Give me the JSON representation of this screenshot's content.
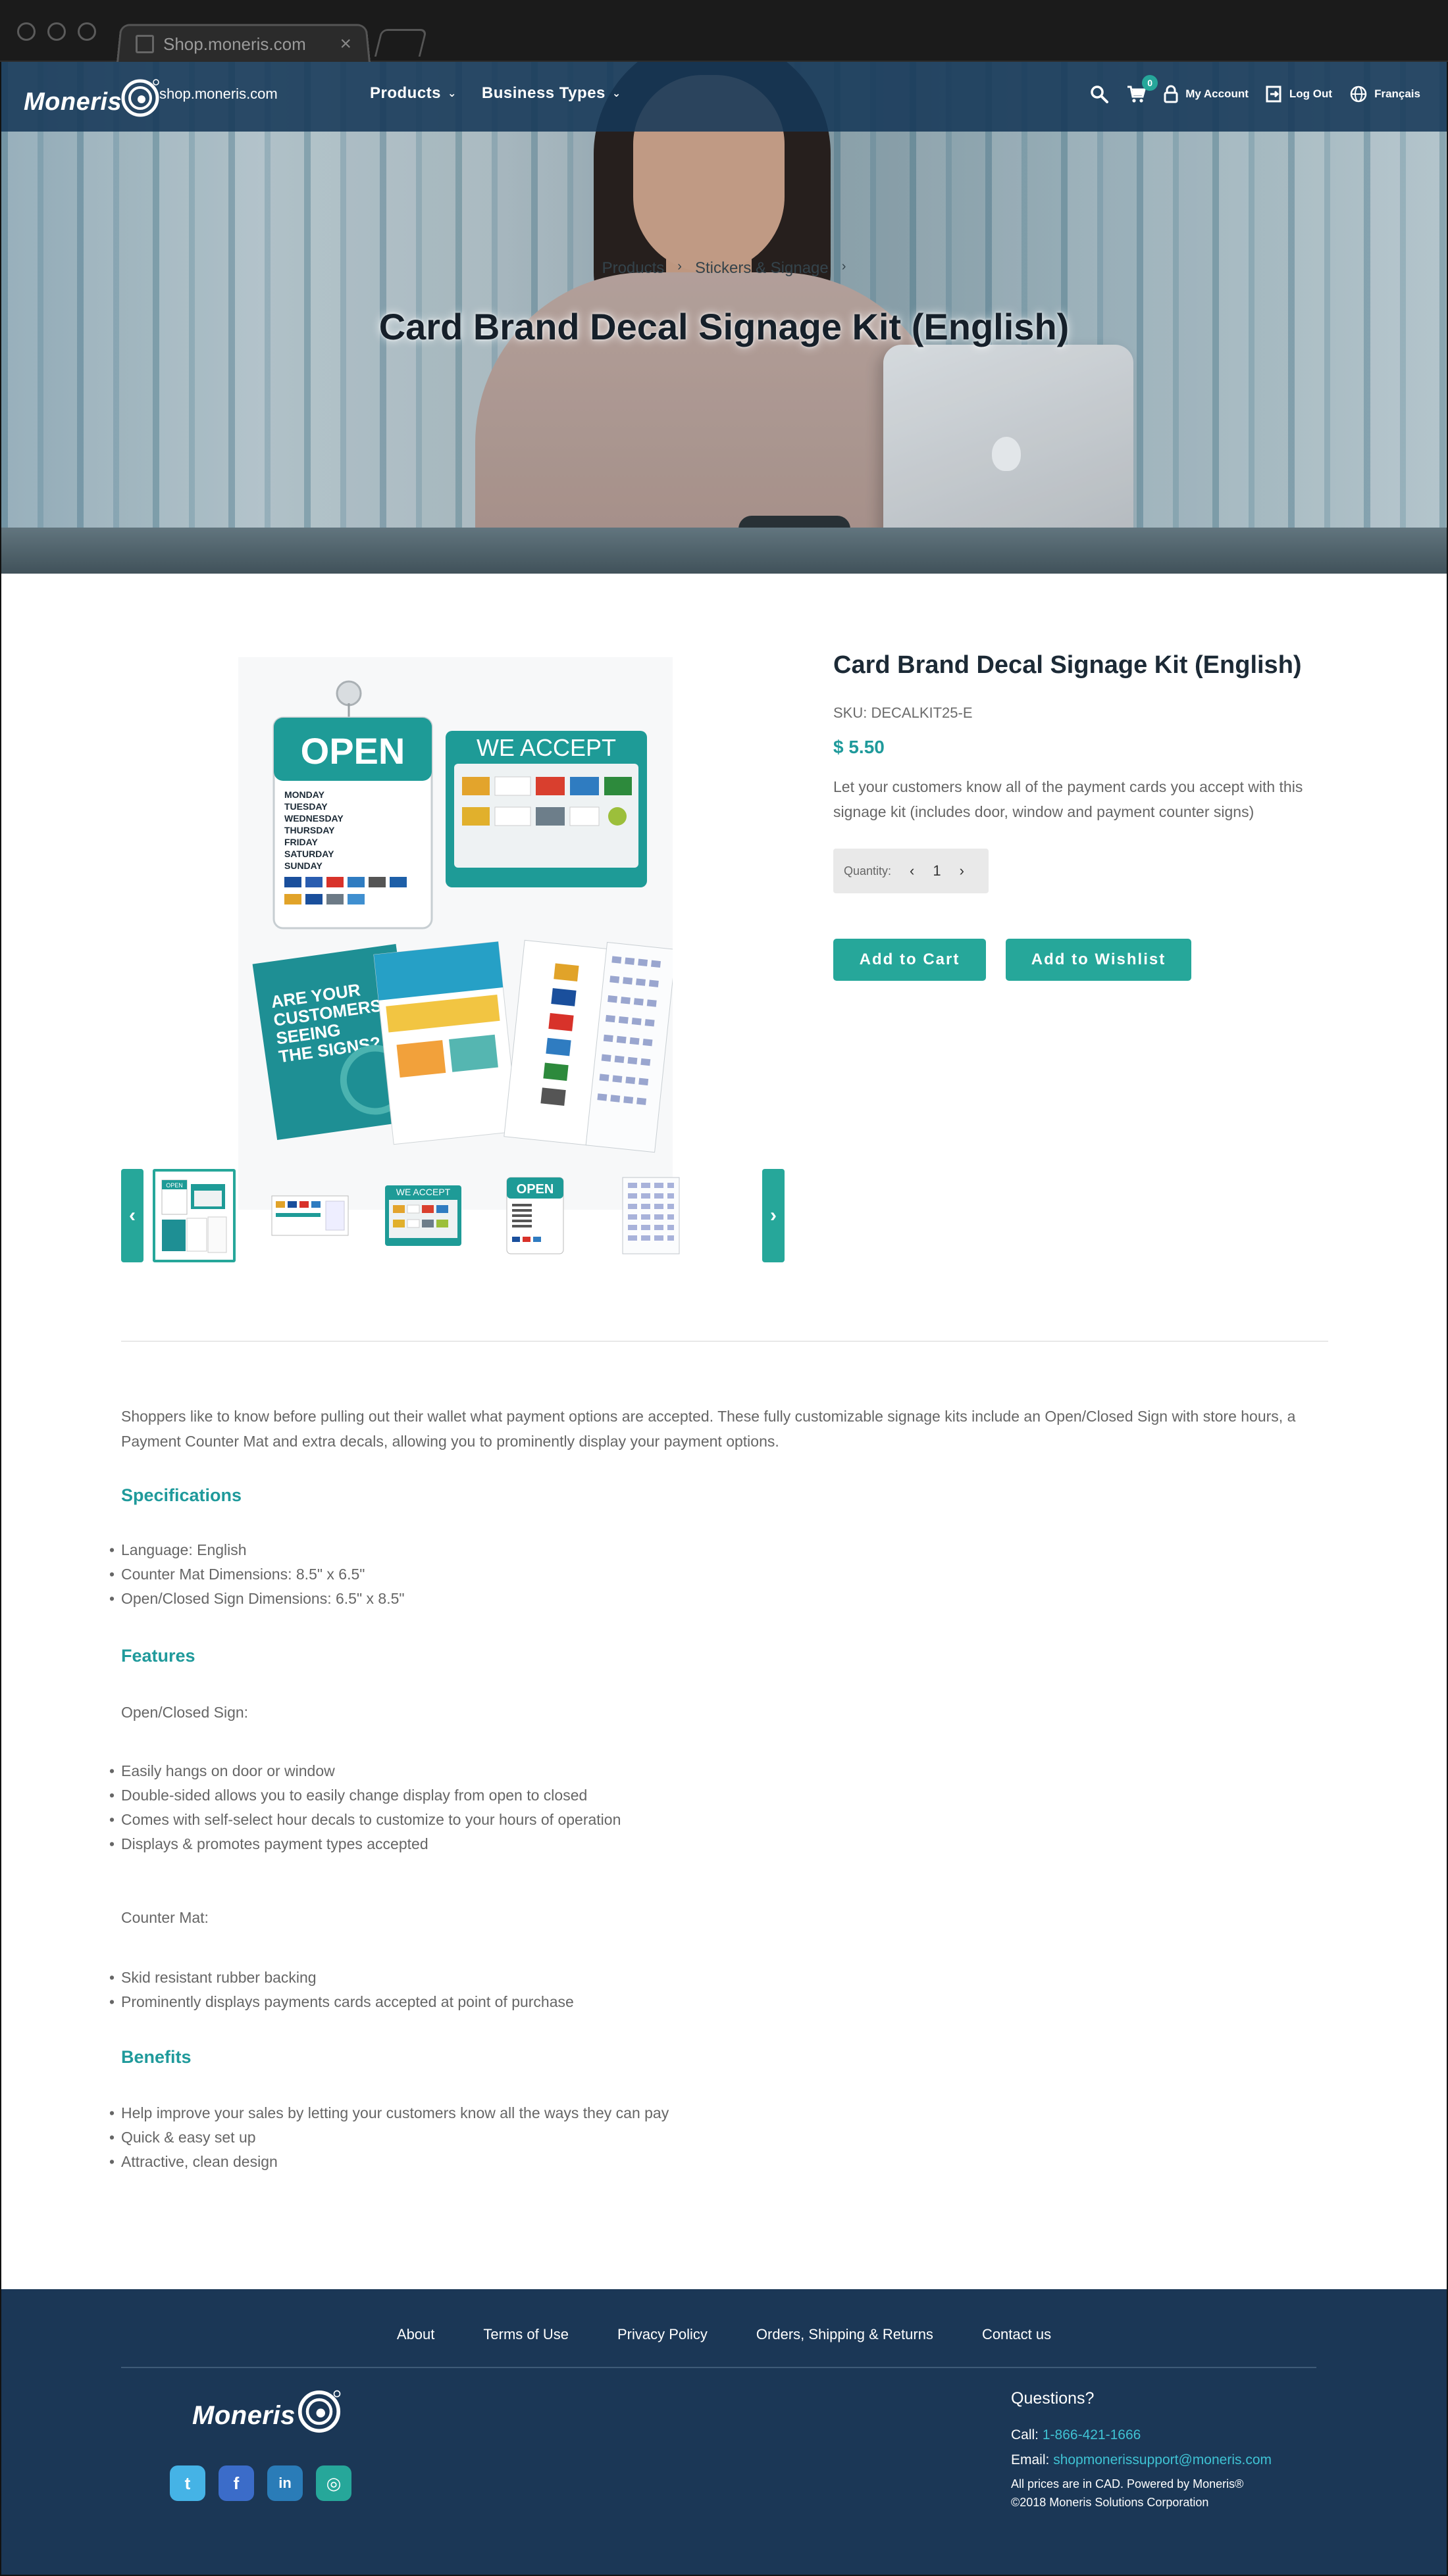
{
  "browser": {
    "tab_title": "Shop.moneris.com",
    "tab_close": "×"
  },
  "nav": {
    "logo_text": "Moneris",
    "domain": "shop.moneris.com",
    "menu": [
      {
        "label": "Products",
        "chevron": "⌄"
      },
      {
        "label": "Business Types",
        "chevron": "⌄"
      }
    ],
    "cart_count": "0",
    "my_account": "My Account",
    "log_out": "Log Out",
    "language": "Français"
  },
  "hero": {
    "breadcrumb": [
      "Products",
      "Stickers & Signage"
    ],
    "breadcrumb_sep": "›",
    "title": "Card Brand Decal Signage Kit (English)"
  },
  "product": {
    "title": "Card Brand Decal Signage Kit (English)",
    "sku": "SKU: DECALKIT25-E",
    "price": "$ 5.50",
    "description": "Let your customers know all of the payment cards you accept with this signage kit (includes door, window and payment counter signs)",
    "quantity_label": "Quantity:",
    "quantity_value": "1",
    "qty_dec": "‹",
    "qty_inc": "›",
    "add_to_cart": "Add to Cart",
    "add_to_wishlist": "Add to Wishlist",
    "image": {
      "open_sign": "OPEN",
      "days": [
        "MONDAY",
        "TUESDAY",
        "WEDNESDAY",
        "THURSDAY",
        "FRIDAY",
        "SATURDAY",
        "SUNDAY"
      ],
      "we_accept": "WE ACCEPT",
      "poster_text": "ARE YOUR CUSTOMERS SEEING THE SIGNS?"
    },
    "thumbs_prev": "‹",
    "thumbs_next": "›",
    "thumbs": [
      {
        "name": "kit",
        "label": "OPEN"
      },
      {
        "name": "decals",
        "label": ""
      },
      {
        "name": "we-accept",
        "label": "WE ACCEPT"
      },
      {
        "name": "open-sign",
        "label": "OPEN"
      },
      {
        "name": "hour-decals",
        "label": ""
      }
    ]
  },
  "details": {
    "intro": "Shoppers like to know before pulling out their wallet what payment options are accepted. These fully customizable signage kits include an Open/Closed Sign with store hours, a Payment Counter Mat and extra decals, allowing you to prominently display your payment options.",
    "specifications_heading": "Specifications",
    "specifications": [
      "Language: English",
      "Counter Mat Dimensions: 8.5\" x 6.5\"",
      "Open/Closed Sign Dimensions: 6.5\" x 8.5\""
    ],
    "features_heading": "Features",
    "open_closed_label": "Open/Closed Sign:",
    "open_closed_features": [
      "Easily hangs on door or window",
      "Double-sided allows you to easily change display from open to closed",
      "Comes with self-select hour decals to customize to your hours of operation",
      "Displays & promotes payment types accepted"
    ],
    "counter_mat_label": "Counter Mat:",
    "counter_mat_features": [
      "Skid resistant rubber backing",
      "Prominently displays payments cards accepted at point of purchase"
    ],
    "benefits_heading": "Benefits",
    "benefits": [
      "Help improve your sales by letting your customers know all the ways they can pay",
      "Quick & easy set up",
      "Attractive, clean design"
    ]
  },
  "footer": {
    "links": [
      "About",
      "Terms of Use",
      "Privacy Policy",
      "Orders, Shipping & Returns",
      "Contact us"
    ],
    "logo_text": "Moneris",
    "social": [
      {
        "name": "twitter",
        "glyph": "t",
        "color": "#45b3e6"
      },
      {
        "name": "facebook",
        "glyph": "f",
        "color": "#3b6cc9"
      },
      {
        "name": "linkedin",
        "glyph": "in",
        "color": "#2a7cb8"
      },
      {
        "name": "moneris",
        "glyph": "◎",
        "color": "#26a79a"
      }
    ],
    "questions_heading": "Questions?",
    "call_label": "Call:",
    "phone": "1-866-421-1666",
    "email_label": "Email:",
    "email": "shopmonerissupport@moneris.com",
    "prices_note": "All prices are in CAD.  Powered by Moneris®",
    "copyright": "©2018 Moneris Solutions Corporation"
  },
  "colors": {
    "accent": "#26a79a",
    "nav_bg": "#1b3756",
    "price": "#1f9a9b"
  }
}
